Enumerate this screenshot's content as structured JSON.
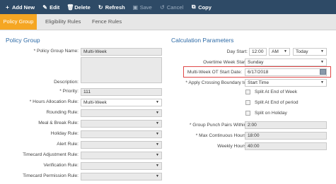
{
  "toolbar": {
    "add_new": "Add New",
    "edit": "Edit",
    "delete": "Delete",
    "refresh": "Refresh",
    "save": "Save",
    "cancel": "Cancel",
    "copy": "Copy"
  },
  "tabs": [
    {
      "label": "Policy Group"
    },
    {
      "label": "Eligibility Rules"
    },
    {
      "label": "Fence Rules"
    }
  ],
  "policy_group": {
    "title": "Policy Group",
    "name_label": "* Policy Group Name:",
    "name_value": "Multi-Week",
    "description_label": "Description:",
    "priority_label": "* Priority:",
    "priority_value": "111",
    "hours_allocation_label": "* Hours Allocation Rule:",
    "hours_allocation_value": "Multi-Week",
    "rounding_label": "Rounding Rule:",
    "meal_break_label": "Meal & Break Rule:",
    "holiday_label": "Holiday Rule:",
    "alert_label": "Alert Rule:",
    "timecard_adjustment_label": "Timecard Adjustment Rule:",
    "verification_label": "Verification Rule:",
    "timecard_permission_label": "Timecard Permission Rule:"
  },
  "calc": {
    "title": "Calculation Parameters",
    "day_start_label": "Day Start:",
    "day_start_time": "12:00",
    "day_start_ampm": "AM",
    "day_start_day": "Today",
    "overtime_week_start_label": "Overtime Week Start:",
    "overtime_week_start_value": "Sunday",
    "multiweek_ot_label": "Multi-Week OT Start Date:",
    "multiweek_ot_value": "6/17/2018",
    "apply_crossing_label": "* Apply Crossing Boundary to:",
    "apply_crossing_value": "Start Time",
    "split_end_week": "Split At End of Week",
    "split_end_period": "Split At End of period",
    "split_holiday": "Split on Holiday",
    "punch_pairs_label": "* Group Punch Pairs Within:",
    "punch_pairs_value": "2:00",
    "max_continuous_label": "* Max Continuous Hours:",
    "max_continuous_value": "18:00",
    "weekly_hours_label": "Weekly Hours:",
    "weekly_hours_value": "40:00"
  },
  "colors": {
    "toolbar_bg": "#2e4a66",
    "tab_active": "#f5a623",
    "section_title": "#2d6aa6",
    "highlight": "#e04848"
  }
}
